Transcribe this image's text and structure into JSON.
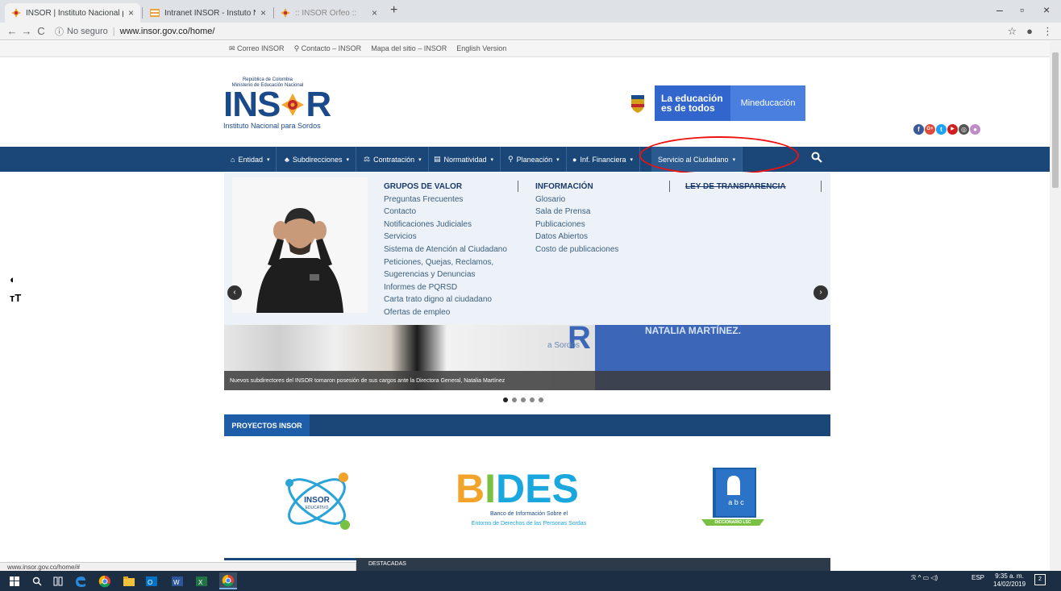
{
  "browser": {
    "tabs": [
      {
        "title": "INSOR | Instituto Nacional para",
        "close": "×",
        "active": true
      },
      {
        "title": "Intranet INSOR - Instuto Naciona",
        "close": "×",
        "active": false
      },
      {
        "title": ":: INSOR Orfeo ::",
        "close": "×",
        "active": false
      }
    ],
    "new_tab": "+",
    "window_controls": {
      "minimize": "–",
      "maximize": "▫",
      "close": "×"
    },
    "nav": {
      "back": "←",
      "forward": "→",
      "reload": "C"
    },
    "omnibox": {
      "security_icon": "ⓘ",
      "security": "No seguro",
      "separator": "|",
      "url": "www.insor.gov.co/home/"
    },
    "toolbar_icons": {
      "bookmark": "☆",
      "profile": "●",
      "menu": "⋮"
    }
  },
  "utility_links": [
    "✉ Correo INSOR",
    "⚲ Contacto – INSOR",
    "Mapa del sitio – INSOR",
    "English Version"
  ],
  "logo": {
    "line1": "República de Colombia",
    "line2": "Ministerio de Educación Nacional",
    "name_left": "INS",
    "name_right": "R",
    "tagline": "Instituto Nacional para Sordos"
  },
  "gov_banner": {
    "edu_line1": "La educación",
    "edu_line2": "es de todos",
    "ministry": "Mineducación"
  },
  "social": [
    {
      "icon": "facebook-icon",
      "glyph": "f",
      "color": "#3b5998"
    },
    {
      "icon": "googleplus-icon",
      "glyph": "G+",
      "color": "#dd4b39"
    },
    {
      "icon": "twitter-icon",
      "glyph": "t",
      "color": "#1da1f2"
    },
    {
      "icon": "youtube-icon",
      "glyph": "▶",
      "color": "#cd201f"
    },
    {
      "icon": "instagram-icon",
      "glyph": "◎",
      "color": "#555555"
    },
    {
      "icon": "flickr-icon",
      "glyph": "●",
      "color": "#c08cc8"
    }
  ],
  "mainnav": [
    {
      "icon": "⌂",
      "label": "Entidad",
      "caret": "▾"
    },
    {
      "icon": "♣",
      "label": "Subdirecciones",
      "caret": "▾"
    },
    {
      "icon": "⚖",
      "label": "Contratación",
      "caret": "▾"
    },
    {
      "icon": "▤",
      "label": "Normatividad",
      "caret": "▾"
    },
    {
      "icon": "⚲",
      "label": "Planeación",
      "caret": "▾"
    },
    {
      "icon": "●",
      "label": "Inf. Financiera",
      "caret": "▾"
    },
    {
      "icon": "",
      "label": "Servicio al Ciudadano",
      "caret": "▾"
    }
  ],
  "mega_menu": {
    "col1": {
      "heading": "GRUPOS DE VALOR",
      "items": [
        "Preguntas Frecuentes",
        "Contacto",
        "Notificaciones Judiciales",
        "Servicios",
        "Sistema de Atención al Ciudadano",
        "Peticiones, Quejas, Reclamos,",
        "Sugerencias y Denuncias",
        "Informes de PQRSD",
        "Carta trato digno al ciudadano",
        "Ofertas de empleo"
      ]
    },
    "col2": {
      "heading": "INFORMACIÓN",
      "items": [
        "Glosario",
        "Sala de Prensa",
        "Publicaciones",
        "Datos Abiertos",
        "Costo de publicaciones"
      ]
    },
    "col3": {
      "heading": "LEY DE TRANSPARENCIA"
    },
    "prev": "‹",
    "next": "›"
  },
  "slider": {
    "caption": "Nuevos subdirectores del INSOR tomaron posesión de sus cargos ante la Directora General, Natalia Martínez",
    "side_text": "NATALIA MARTÍNEZ.",
    "watermark_letter": "R",
    "watermark_text": "a Sordos",
    "slides": 5,
    "active_slide": 1
  },
  "projects": {
    "heading": "PROYECTOS INSOR",
    "insor_edu": {
      "line1": "INSOR",
      "line2": "EDUCATIVO"
    },
    "bides": {
      "w1": "B",
      "w2": "I",
      "w3": "DES",
      "sub1": "Banco de Información Sobre el",
      "sub2": "Entorno de Derechos de las Personas Sordas"
    },
    "abc": {
      "letters": "a b c",
      "label": "DICCIONARIO LSC"
    }
  },
  "destacadas": "DESTACADAS",
  "accessibility": {
    "contrast": "◐",
    "font_size": "тT"
  },
  "status_url": "www.insor.gov.co/home/#",
  "taskbar": {
    "time": "9:35 a. m.",
    "date": "14/02/2019",
    "lang": "ESP",
    "tray": "ℛ  ^  ▭  ◁)",
    "notifications_count": "2"
  }
}
